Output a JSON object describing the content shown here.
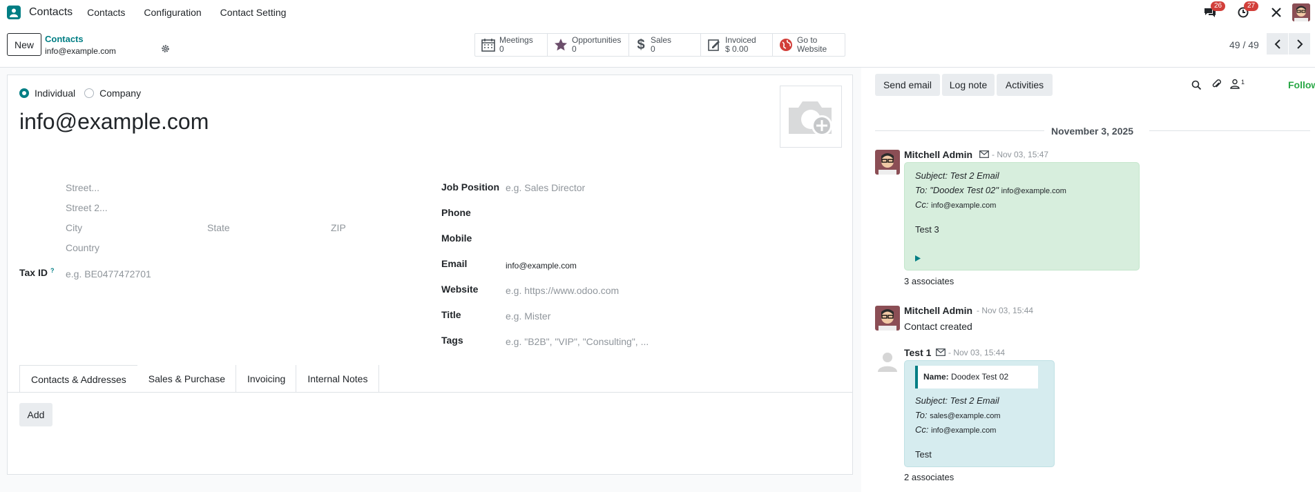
{
  "navbar": {
    "app_name": "Contacts",
    "menu": [
      "Contacts",
      "Configuration",
      "Contact Setting"
    ],
    "messages_badge": "26",
    "activities_badge": "27"
  },
  "control": {
    "new_label": "New",
    "breadcrumb_parent": "Contacts",
    "breadcrumb_current": "info@example.com",
    "pager": "49 / 49",
    "stats": [
      {
        "label": "Meetings",
        "value": "0",
        "icon": "calendar-icon"
      },
      {
        "label": "Opportunities",
        "value": "0",
        "icon": "star-icon"
      },
      {
        "label": "Sales",
        "value": "0",
        "icon": "dollar-icon"
      },
      {
        "label": "Invoiced",
        "value": "$ 0.00",
        "icon": "invoice-icon"
      },
      {
        "label": "Go to",
        "value": "Website",
        "icon": "globe-icon"
      }
    ]
  },
  "form": {
    "type_individual": "Individual",
    "type_company": "Company",
    "name": "info@example.com",
    "placeholders": {
      "street": "Street...",
      "street2": "Street 2...",
      "city": "City",
      "state": "State",
      "zip": "ZIP",
      "country": "Country",
      "tax_id": "e.g. BE0477472701",
      "job_position": "e.g. Sales Director",
      "website": "e.g. https://www.odoo.com",
      "title": "e.g. Mister",
      "tags": "e.g. \"B2B\", \"VIP\", \"Consulting\", ..."
    },
    "labels": {
      "tax_id": "Tax ID",
      "tax_help": "?",
      "job_position": "Job Position",
      "phone": "Phone",
      "mobile": "Mobile",
      "email": "Email",
      "website": "Website",
      "title": "Title",
      "tags": "Tags"
    },
    "email_value": "info@example.com",
    "tabs": [
      "Contacts & Addresses",
      "Sales & Purchase",
      "Invoicing",
      "Internal Notes"
    ],
    "add_label": "Add"
  },
  "chatter": {
    "send_email": "Send email",
    "log_note": "Log note",
    "activities": "Activities",
    "followers_count": "1",
    "following": "Following",
    "date": "November 3, 2025",
    "messages": [
      {
        "author": "Mitchell Admin",
        "time": "- Nov 03, 15:47",
        "subject": "Subject: Test 2 Email",
        "to_label": "To: \"Doodex Test 02\"",
        "to_value": "info@example.com",
        "cc_label": "Cc:",
        "cc_value": "info@example.com",
        "body": "Test 3",
        "associates": "3 associates"
      },
      {
        "author": "Mitchell Admin",
        "time": "- Nov 03, 15:44",
        "body": "Contact created"
      },
      {
        "author": "Test 1",
        "time": "- Nov 03, 15:44",
        "name_label": "Name:",
        "name_value": "Doodex Test 02",
        "subject": "Subject: Test 2 Email",
        "to_label": "To:",
        "to_value": "sales@example.com",
        "cc_label": "Cc:",
        "cc_value": "info@example.com",
        "body": "Test",
        "associates": "2 associates"
      }
    ]
  },
  "colors": {
    "accent": "#017e84",
    "badge": "#d23f3a",
    "following": "#28a745"
  }
}
